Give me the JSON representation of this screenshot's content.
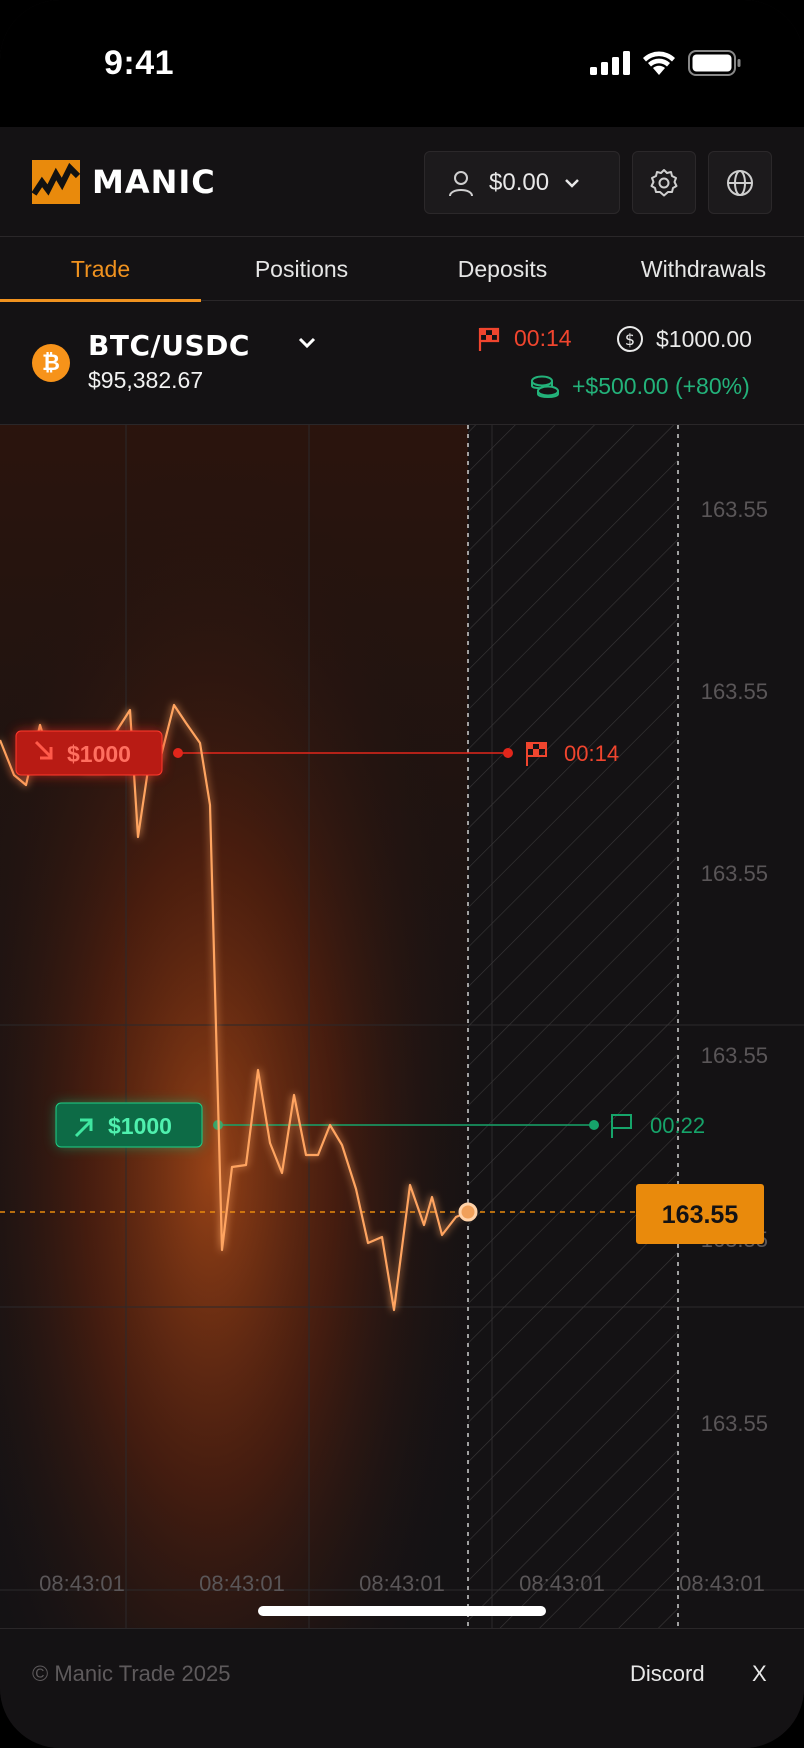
{
  "status_bar": {
    "time": "9:41"
  },
  "header": {
    "brand": "MANIC",
    "account_balance": "$0.00",
    "icons": [
      "user-icon",
      "chevron-down-icon",
      "gear-icon",
      "globe-icon"
    ]
  },
  "tabs": [
    {
      "label": "Trade",
      "active": true
    },
    {
      "label": "Positions",
      "active": false
    },
    {
      "label": "Deposits",
      "active": false
    },
    {
      "label": "Withdrawals",
      "active": false
    }
  ],
  "pair": {
    "name": "BTC/USDC",
    "price": "$95,382.67",
    "timer": "00:14",
    "stake": "$1000.00",
    "payout": "+$500.00 (+80%)"
  },
  "chart": {
    "y_ticks": [
      "163.55",
      "163.55",
      "163.55",
      "163.55",
      "163.55",
      "163.55"
    ],
    "x_ticks": [
      "08:43:01",
      "08:43:01",
      "08:43:01",
      "08:43:01",
      "08:43:01"
    ],
    "current_price": "163.55",
    "down_order": {
      "amount": "$1000",
      "timer": "00:14"
    },
    "up_order": {
      "amount": "$1000",
      "timer": "00:22"
    },
    "colors": {
      "line": "#ff9a4a",
      "down": "#e2261b",
      "up": "#16a46a",
      "accent": "#e98a0c"
    }
  },
  "footer": {
    "copyright": "© Manic Trade 2025",
    "links": [
      "Discord",
      "X"
    ]
  }
}
